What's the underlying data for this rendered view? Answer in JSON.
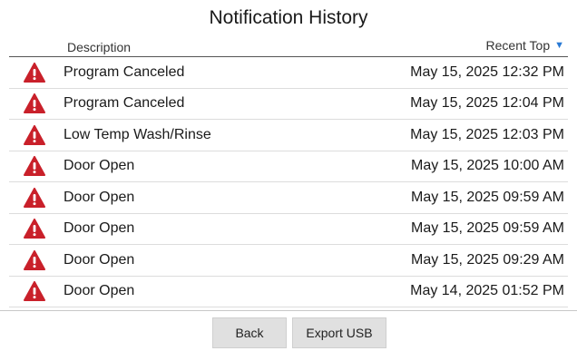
{
  "title": "Notification History",
  "columns": {
    "description": "Description",
    "sort_label": "Recent Top",
    "sort_arrow": "▼"
  },
  "colors": {
    "alert_icon": "#c9202a",
    "sort_arrow": "#2a7ad5"
  },
  "notifications": [
    {
      "icon": "warning-icon",
      "description": "Program Canceled",
      "timestamp": "May 15, 2025 12:32 PM"
    },
    {
      "icon": "warning-icon",
      "description": "Program Canceled",
      "timestamp": "May 15, 2025 12:04 PM"
    },
    {
      "icon": "warning-icon",
      "description": "Low Temp Wash/Rinse",
      "timestamp": "May 15, 2025 12:03 PM"
    },
    {
      "icon": "warning-icon",
      "description": "Door Open",
      "timestamp": "May 15, 2025 10:00 AM"
    },
    {
      "icon": "warning-icon",
      "description": "Door Open",
      "timestamp": "May 15, 2025 09:59 AM"
    },
    {
      "icon": "warning-icon",
      "description": "Door Open",
      "timestamp": "May 15, 2025 09:59 AM"
    },
    {
      "icon": "warning-icon",
      "description": "Door Open",
      "timestamp": "May 15, 2025 09:29 AM"
    },
    {
      "icon": "warning-icon",
      "description": "Door Open",
      "timestamp": "May 14, 2025 01:52 PM"
    }
  ],
  "buttons": {
    "back": "Back",
    "export": "Export USB"
  }
}
